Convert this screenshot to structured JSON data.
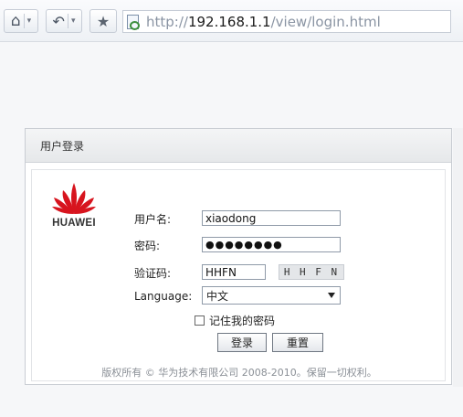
{
  "browser": {
    "url_scheme": "http://",
    "url_host": "192.168.1.1",
    "url_path": "/view/login.html",
    "home_icon": "⌂",
    "back_icon": "↶",
    "fav_icon": "★",
    "dropdown_icon": "▾"
  },
  "panel": {
    "title": "用户登录"
  },
  "brand": {
    "logo_text": "HUAWEI",
    "logo_color": "#d7141e"
  },
  "form": {
    "username_label": "用户名:",
    "username_value": "xiaodong",
    "password_label": "密码:",
    "password_value": "●●●●●●●●",
    "captcha_label": "验证码:",
    "captcha_value": "HHFN",
    "captcha_image_text": "H H F N",
    "language_label": "Language:",
    "language_value": "中文",
    "remember_label": "记住我的密码",
    "login_button": "登录",
    "reset_button": "重置"
  },
  "footer": {
    "copyright": "版权所有 © 华为技术有限公司 2008-2010。保留一切权利。"
  }
}
